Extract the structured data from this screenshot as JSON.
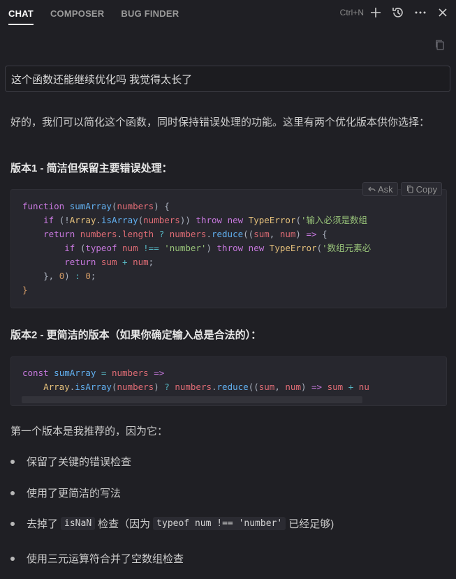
{
  "tabs": [
    {
      "label": "CHAT",
      "active": true
    },
    {
      "label": "COMPOSER",
      "active": false
    },
    {
      "label": "BUG FINDER",
      "active": false
    }
  ],
  "header": {
    "shortcut": "Ctrl+N",
    "icons": [
      "plus-icon",
      "history-icon",
      "more-icon",
      "close-icon"
    ]
  },
  "user_message": "这个函数还能继续优化吗 我觉得太长了",
  "assistant": {
    "intro": "好的，我们可以简化这个函数，同时保持错误处理的功能。这里有两个优化版本供你选择：",
    "version1_heading": "版本1 - 简洁但保留主要错误处理：",
    "version2_heading": "版本2 - 更简洁的版本（如果你确定输入总是合法的）：",
    "recommend": "第一个版本是我推荐的，因为它：",
    "code_actions": {
      "ask": "Ask",
      "copy": "Copy"
    },
    "bullets": [
      {
        "text": "保留了关键的错误检查"
      },
      {
        "text": "使用了更简洁的写法"
      },
      {
        "before": "去掉了",
        "code1": "isNaN",
        "middle": "检查（因为",
        "code2": "typeof num !== 'number'",
        "after": "已经足够)"
      },
      {
        "text": "使用三元运算符合并了空数组检查"
      }
    ],
    "code1_strings": [
      "'输入必须是数组",
      "'数组元素必"
    ],
    "code2_tail": "nu"
  },
  "colors": {
    "background": "#1f1f24",
    "code_background": "#27272e",
    "keyword": "#c678dd",
    "function": "#61afef",
    "variable": "#e5c07b",
    "string": "#98c379"
  }
}
